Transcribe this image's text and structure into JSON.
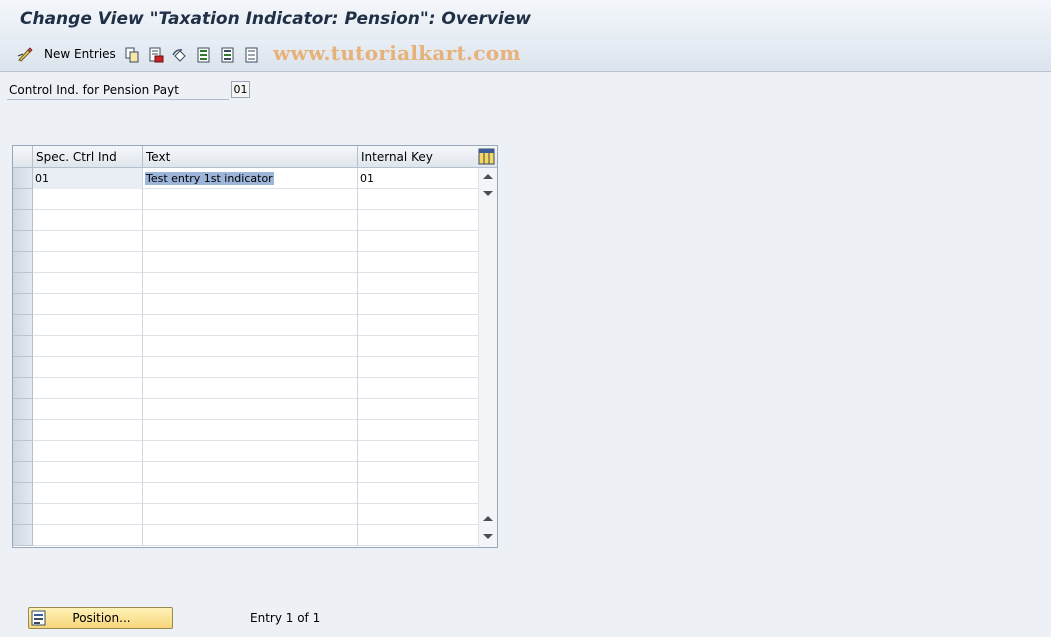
{
  "window": {
    "title": "Change View \"Taxation Indicator: Pension\": Overview"
  },
  "toolbar": {
    "new_entries_label": "New Entries",
    "icons": [
      "change-display-icon",
      "copy-icon",
      "delete-icon",
      "undo-icon",
      "select-all-icon",
      "select-block-icon",
      "deselect-all-icon"
    ],
    "watermark": "www.tutorialkart.com"
  },
  "header_field": {
    "label": "Control Ind. for Pension Payt",
    "value": "01"
  },
  "table": {
    "columns": [
      "Spec. Ctrl Ind",
      "Text",
      "Internal Key"
    ],
    "rows": [
      {
        "spec_ctrl_ind": "01",
        "text": "Test entry 1st indicator",
        "internal_key": "01"
      }
    ],
    "empty_rows": 17
  },
  "footer": {
    "position_button_label": "Position...",
    "entry_count": "Entry 1 of 1"
  },
  "colors": {
    "title": "#1f2f45",
    "watermark": "#e7b27a",
    "highlight": "#9db5d9",
    "button": "#f6d57a"
  }
}
